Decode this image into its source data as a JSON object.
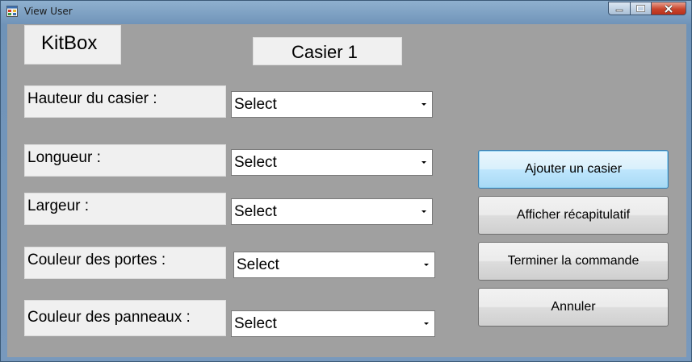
{
  "window": {
    "title": "View User",
    "icon": "app-window-icon"
  },
  "header": {
    "brand": "KitBox",
    "section": "Casier 1"
  },
  "form": {
    "fields": [
      {
        "label": "Hauteur du casier :",
        "value": "Select"
      },
      {
        "label": "Longueur :",
        "value": "Select"
      },
      {
        "label": "Largeur :",
        "value": "Select"
      },
      {
        "label": "Couleur des portes :",
        "value": "Select"
      },
      {
        "label": "Couleur des panneaux :",
        "value": "Select"
      }
    ]
  },
  "actions": {
    "add": "Ajouter un casier",
    "summary": "Afficher récapitulatif",
    "finish": "Terminer la commande",
    "cancel": "Annuler"
  }
}
